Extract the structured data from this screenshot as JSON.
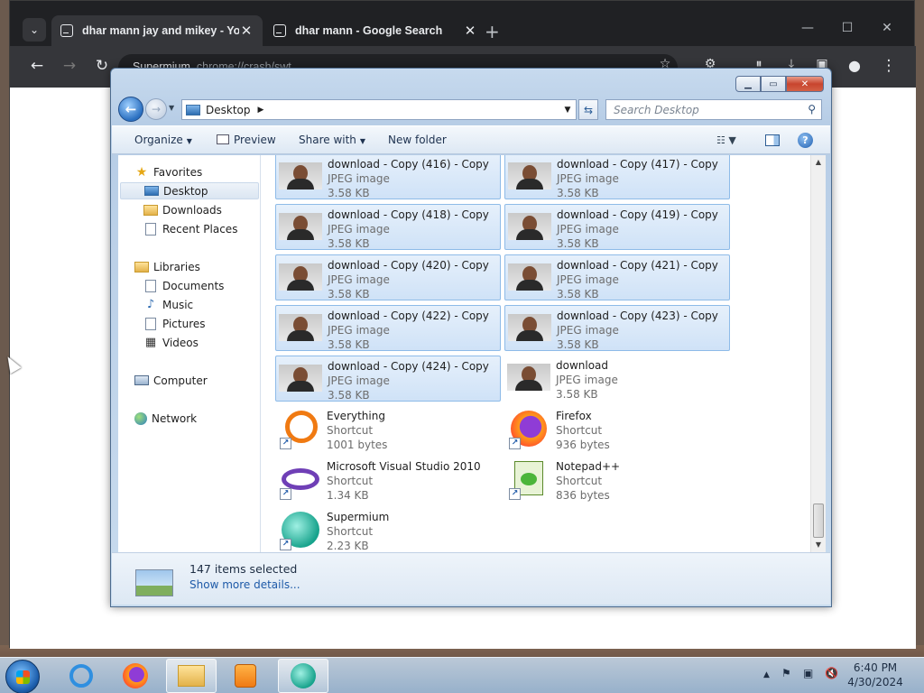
{
  "browser": {
    "tabs": [
      {
        "title": "dhar mann jay and mikey - You",
        "active": true
      },
      {
        "title": "dhar mann - Google Search",
        "active": false
      }
    ],
    "tab_close_glyph": "✕",
    "new_tab_glyph": "+",
    "omnibox": {
      "host": "Supermium",
      "path": "chrome://crash/swt"
    }
  },
  "explorer": {
    "address": {
      "location": "Desktop"
    },
    "search_placeholder": "Search Desktop",
    "commands": {
      "organize": "Organize",
      "preview": "Preview",
      "share_with": "Share with",
      "new_folder": "New folder"
    },
    "nav": {
      "favorites": "Favorites",
      "favorites_items": [
        "Desktop",
        "Downloads",
        "Recent Places"
      ],
      "libraries": "Libraries",
      "libraries_items": [
        "Documents",
        "Music",
        "Pictures",
        "Videos"
      ],
      "computer": "Computer",
      "network": "Network"
    },
    "files": [
      {
        "name": "download - Copy (416) - Copy",
        "type": "JPEG image",
        "size": "3.58 KB",
        "icon": "photo-thumbnail",
        "selected": true
      },
      {
        "name": "download - Copy (417) - Copy",
        "type": "JPEG image",
        "size": "3.58 KB",
        "icon": "photo-thumbnail",
        "selected": true
      },
      {
        "name": "download - Copy (418) - Copy",
        "type": "JPEG image",
        "size": "3.58 KB",
        "icon": "photo-thumbnail",
        "selected": true
      },
      {
        "name": "download - Copy (419) - Copy",
        "type": "JPEG image",
        "size": "3.58 KB",
        "icon": "photo-thumbnail",
        "selected": true
      },
      {
        "name": "download - Copy (420) - Copy",
        "type": "JPEG image",
        "size": "3.58 KB",
        "icon": "photo-thumbnail",
        "selected": true
      },
      {
        "name": "download - Copy (421) - Copy",
        "type": "JPEG image",
        "size": "3.58 KB",
        "icon": "photo-thumbnail",
        "selected": true
      },
      {
        "name": "download - Copy (422) - Copy",
        "type": "JPEG image",
        "size": "3.58 KB",
        "icon": "photo-thumbnail",
        "selected": true
      },
      {
        "name": "download - Copy (423) - Copy",
        "type": "JPEG image",
        "size": "3.58 KB",
        "icon": "photo-thumbnail",
        "selected": true
      },
      {
        "name": "download - Copy (424) - Copy",
        "type": "JPEG image",
        "size": "3.58 KB",
        "icon": "photo-thumbnail",
        "selected": true
      },
      {
        "name": "download",
        "type": "JPEG image",
        "size": "3.58 KB",
        "icon": "photo-thumbnail",
        "selected": false
      },
      {
        "name": "Everything",
        "type": "Shortcut",
        "size": "1001 bytes",
        "icon": "everything-icon",
        "selected": false
      },
      {
        "name": "Firefox",
        "type": "Shortcut",
        "size": "936 bytes",
        "icon": "firefox-icon",
        "selected": false
      },
      {
        "name": "Microsoft Visual Studio 2010",
        "type": "Shortcut",
        "size": "1.34 KB",
        "icon": "visual-studio-icon",
        "selected": false
      },
      {
        "name": "Notepad++",
        "type": "Shortcut",
        "size": "836 bytes",
        "icon": "notepad-plus-plus-icon",
        "selected": false
      },
      {
        "name": "Supermium",
        "type": "Shortcut",
        "size": "2.23 KB",
        "icon": "supermium-icon",
        "selected": false
      }
    ],
    "details": {
      "count": "147 items selected",
      "link": "Show more details..."
    }
  },
  "taskbar": {
    "apps": [
      "internet-explorer-icon",
      "firefox-icon",
      "explorer-folder-icon",
      "media-player-icon",
      "supermium-icon"
    ],
    "clock": {
      "time": "6:40 PM",
      "date": "4/30/2024"
    }
  },
  "colors": {
    "selection_border": "#8ebbe8",
    "link": "#1e5aa8",
    "chrome_dark": "#202124"
  }
}
